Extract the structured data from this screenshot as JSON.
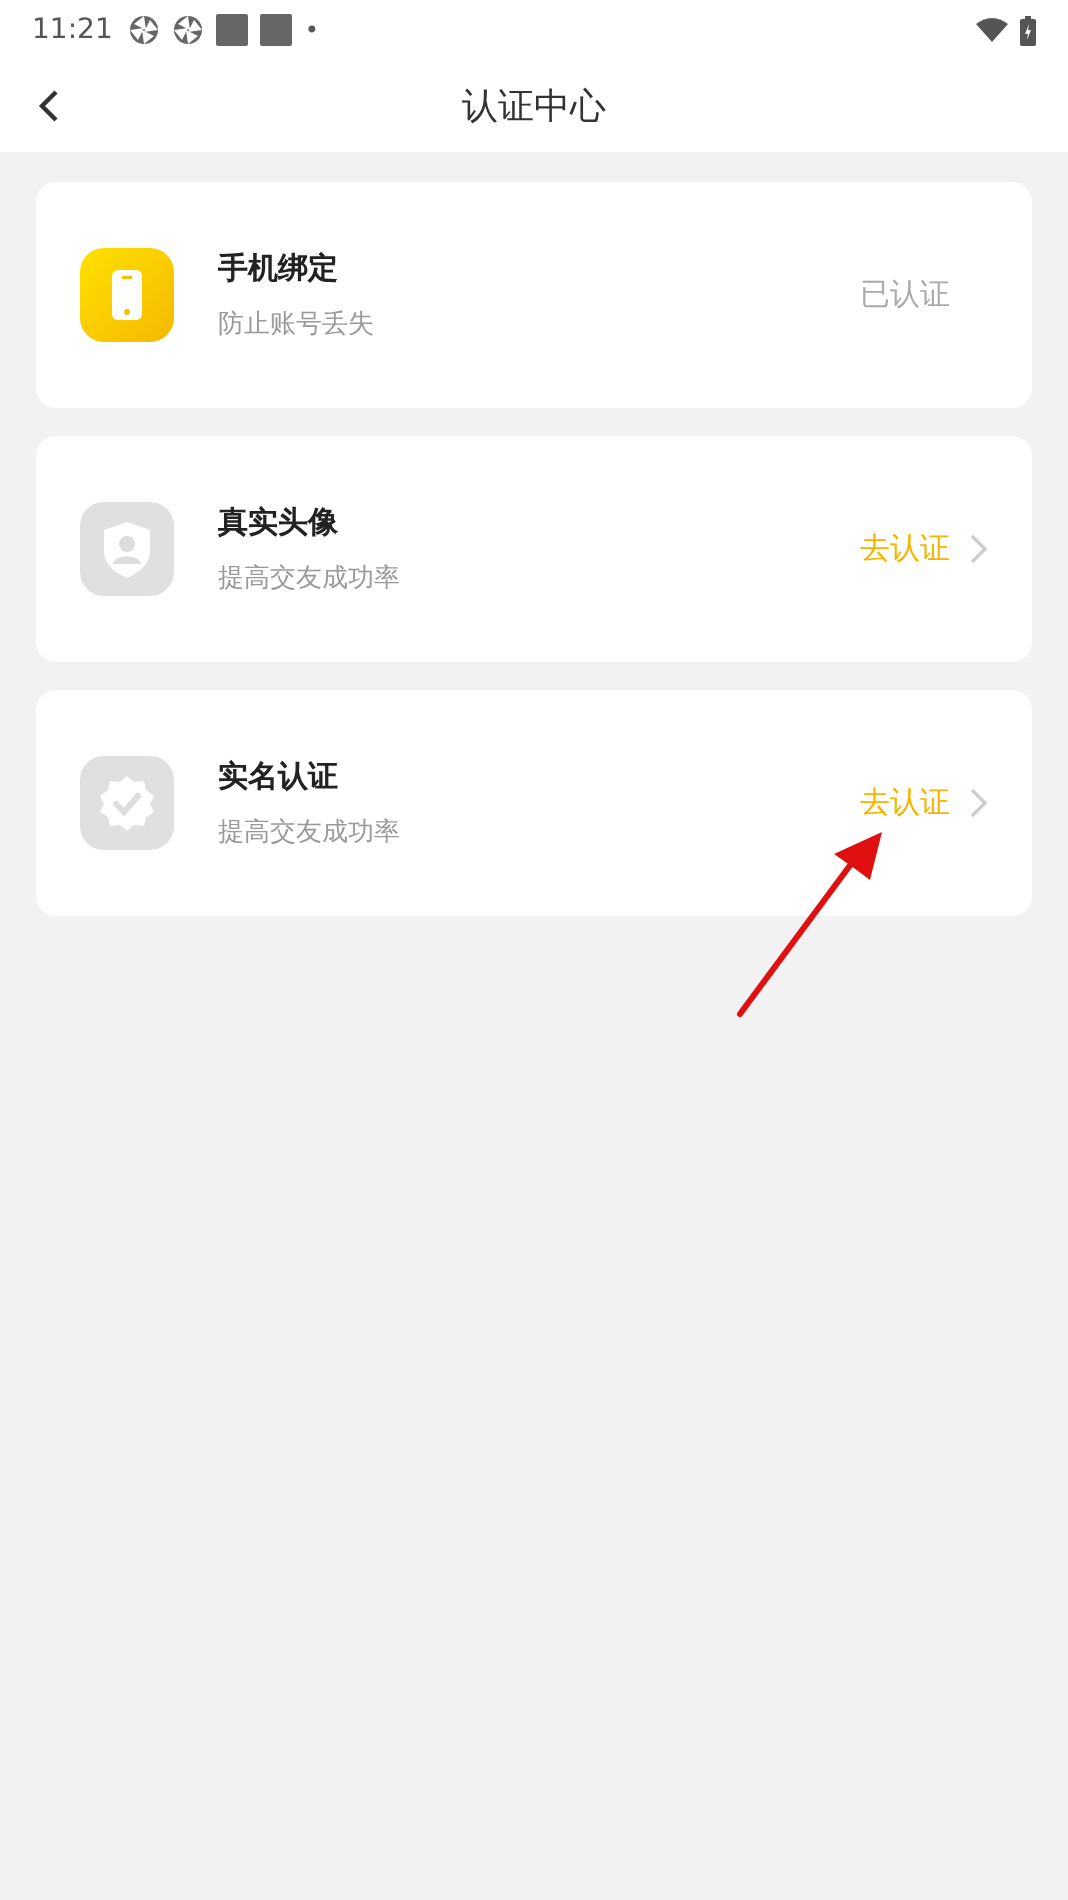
{
  "status_bar": {
    "time": "11:21",
    "dot": "•"
  },
  "header": {
    "title": "认证中心"
  },
  "items": [
    {
      "kind": "phone",
      "title": "手机绑定",
      "subtitle": "防止账号丢失",
      "status": "已认证",
      "verified": true
    },
    {
      "kind": "portrait",
      "title": "真实头像",
      "subtitle": "提高交友成功率",
      "status": "去认证",
      "verified": false
    },
    {
      "kind": "badge",
      "title": "实名认证",
      "subtitle": "提高交友成功率",
      "status": "去认证",
      "verified": false
    }
  ]
}
